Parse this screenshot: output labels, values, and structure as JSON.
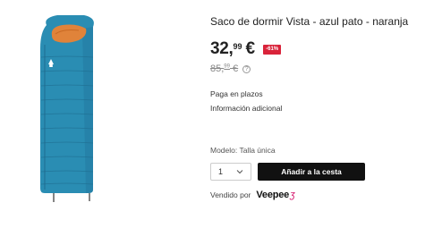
{
  "product": {
    "title": "Saco de dormir Vista - azul pato - naranja",
    "image_icon": "sleeping-bag-image"
  },
  "price": {
    "integer": "32,",
    "decimal": "99",
    "currency": "€",
    "discount": "-61%",
    "old_integer": "85,",
    "old_decimal": "99",
    "old_currency": "€",
    "help_icon": "?"
  },
  "links": {
    "installments": "Paga en plazos",
    "additional_info": "Información adicional"
  },
  "model": {
    "text": "Modelo: Talla única"
  },
  "quantity": {
    "value": "1"
  },
  "cart": {
    "add_label": "Añadir a la cesta"
  },
  "seller": {
    "label": "Vendido por",
    "brand": "Veepee",
    "brand_mark": "ʒ"
  },
  "colors": {
    "bag_blue": "#2a8db3",
    "bag_orange": "#e0833a",
    "discount_red": "#d9233a",
    "button_black": "#111111",
    "brand_pink": "#d4146b"
  }
}
